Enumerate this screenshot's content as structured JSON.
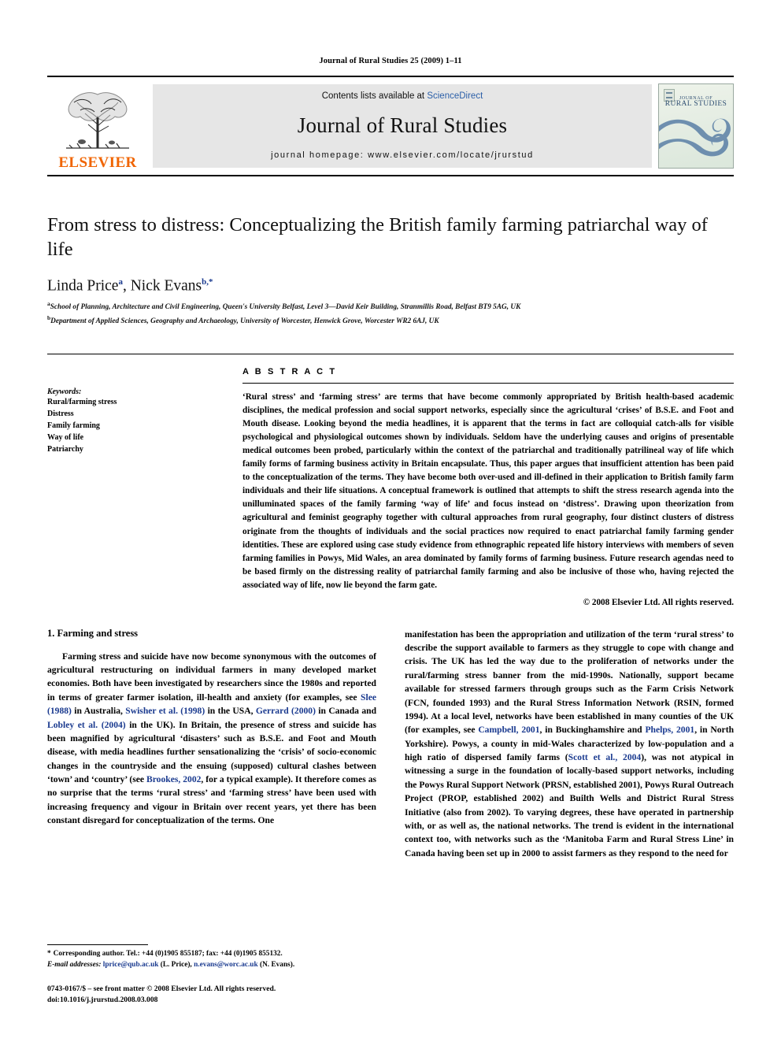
{
  "running_head": "Journal of Rural Studies 25 (2009) 1–11",
  "masthead": {
    "publisher_name": "ELSEVIER",
    "contents_prefix": "Contents lists available at",
    "contents_link": "ScienceDirect",
    "journal_name": "Journal of Rural Studies",
    "homepage": "journal homepage: www.elsevier.com/locate/jrurstud",
    "cover": {
      "line1": "JOURNAL OF",
      "line2": "RURAL STUDIES"
    }
  },
  "article": {
    "title": "From stress to distress: Conceptualizing the British family farming patriarchal way of life",
    "authors": [
      {
        "name": "Linda Price",
        "marker": "a"
      },
      {
        "name": "Nick Evans",
        "marker": "b,*"
      }
    ],
    "affiliations": [
      {
        "marker": "a",
        "text": "School of Planning, Architecture and Civil Engineering, Queen's University Belfast, Level 3—David Keir Building, Stranmillis Road, Belfast BT9 5AG, UK"
      },
      {
        "marker": "b",
        "text": "Department of Applied Sciences, Geography and Archaeology, University of Worcester, Henwick Grove, Worcester WR2 6AJ, UK"
      }
    ]
  },
  "keywords": {
    "label": "Keywords:",
    "items": [
      "Rural/farming stress",
      "Distress",
      "Family farming",
      "Way of life",
      "Patriarchy"
    ]
  },
  "abstract": {
    "heading": "A B S T R A C T",
    "text": "‘Rural stress’ and ‘farming stress’ are terms that have become commonly appropriated by British health-based academic disciplines, the medical profession and social support networks, especially since the agricultural ‘crises’ of B.S.E. and Foot and Mouth disease. Looking beyond the media headlines, it is apparent that the terms in fact are colloquial catch-alls for visible psychological and physiological outcomes shown by individuals. Seldom have the underlying causes and origins of presentable medical outcomes been probed, particularly within the context of the patriarchal and traditionally patrilineal way of life which family forms of farming business activity in Britain encapsulate. Thus, this paper argues that insufficient attention has been paid to the conceptualization of the terms. They have become both over-used and ill-defined in their application to British family farm individuals and their life situations. A conceptual framework is outlined that attempts to shift the stress research agenda into the unilluminated spaces of the family farming ‘way of life’ and focus instead on ‘distress’. Drawing upon theorization from agricultural and feminist geography together with cultural approaches from rural geography, four distinct clusters of distress originate from the thoughts of individuals and the social practices now required to enact patriarchal family farming gender identities. These are explored using case study evidence from ethnographic repeated life history interviews with members of seven farming families in Powys, Mid Wales, an area dominated by family forms of farming business. Future research agendas need to be based firmly on the distressing reality of patriarchal family farming and also be inclusive of those who, having rejected the associated way of life, now lie beyond the farm gate.",
    "copyright": "© 2008 Elsevier Ltd. All rights reserved."
  },
  "body": {
    "section_heading": "1. Farming and stress",
    "left_paragraph_part1": "Farming stress and suicide have now become synonymous with the outcomes of agricultural restructuring on individual farmers in many developed market economies. Both have been investigated by researchers since the 1980s and reported in terms of greater farmer isolation, ill-health and anxiety (for examples, see ",
    "cite_slee": "Slee (1988)",
    "left_paragraph_part2": " in Australia, ",
    "cite_swisher": "Swisher et al. (1998)",
    "left_paragraph_part3": " in the USA, ",
    "cite_gerrard": "Gerrard (2000)",
    "left_paragraph_part4": " in Canada and ",
    "cite_lobley": "Lobley et al. (2004)",
    "left_paragraph_part5": " in the UK). In Britain, the presence of stress and suicide has been magnified by agricultural ‘disasters’ such as B.S.E. and Foot and Mouth disease, with media headlines further sensationalizing the ‘crisis’ of socio-economic changes in the countryside and the ensuing (supposed) cultural clashes between ‘town’ and ‘country’ (see ",
    "cite_brookes": "Brookes, 2002",
    "left_paragraph_part6": ", for a typical example). It therefore comes as no surprise that the terms ‘rural stress’ and ‘farming stress’ have been used with increasing frequency and vigour in Britain over recent years, yet there has been constant disregard for conceptualization of the terms. One",
    "right_paragraph_part1": "manifestation has been the appropriation and utilization of the term ‘rural stress’ to describe the support available to farmers as they struggle to cope with change and crisis. The UK has led the way due to the proliferation of networks under the rural/farming stress banner from the mid-1990s. Nationally, support became available for stressed farmers through groups such as the Farm Crisis Network (FCN, founded 1993) and the Rural Stress Information Network (RSIN, formed 1994). At a local level, networks have been established in many counties of the UK (for examples, see ",
    "cite_campbell": "Campbell, 2001",
    "right_paragraph_part2": ", in Buckinghamshire and ",
    "cite_phelps": "Phelps, 2001",
    "right_paragraph_part3": ", in North Yorkshire). Powys, a county in mid-Wales characterized by low-population and a high ratio of dispersed family farms (",
    "cite_scott": "Scott et al., 2004",
    "right_paragraph_part4": "), was not atypical in witnessing a surge in the foundation of locally-based support networks, including the Powys Rural Support Network (PRSN, established 2001), Powys Rural Outreach Project (PROP, established 2002) and Builth Wells and District Rural Stress Initiative (also from 2002). To varying degrees, these have operated in partnership with, or as well as, the national networks. The trend is evident in the international context too, with networks such as the ‘Manitoba Farm and Rural Stress Line’ in Canada having been set up in 2000 to assist farmers as they respond to the need for"
  },
  "footnotes": {
    "corresponding": "Corresponding author. Tel.: +44 (0)1905 855187; fax: +44 (0)1905 855132.",
    "email_label": "E-mail addresses:",
    "email1": "lprice@qub.ac.uk",
    "email1_owner": "(L. Price),",
    "email2": "n.evans@worc.ac.uk",
    "email2_owner": "(N. Evans).",
    "issn_line": "0743-0167/$ – see front matter © 2008 Elsevier Ltd. All rights reserved.",
    "doi_line": "doi:10.1016/j.jrurstud.2008.03.008"
  },
  "colors": {
    "elsevier_orange": "#F06400",
    "link_blue": "#1a3a8f",
    "sciencedirect_blue": "#2b5fa8",
    "masthead_grey": "#e6e6e6"
  }
}
